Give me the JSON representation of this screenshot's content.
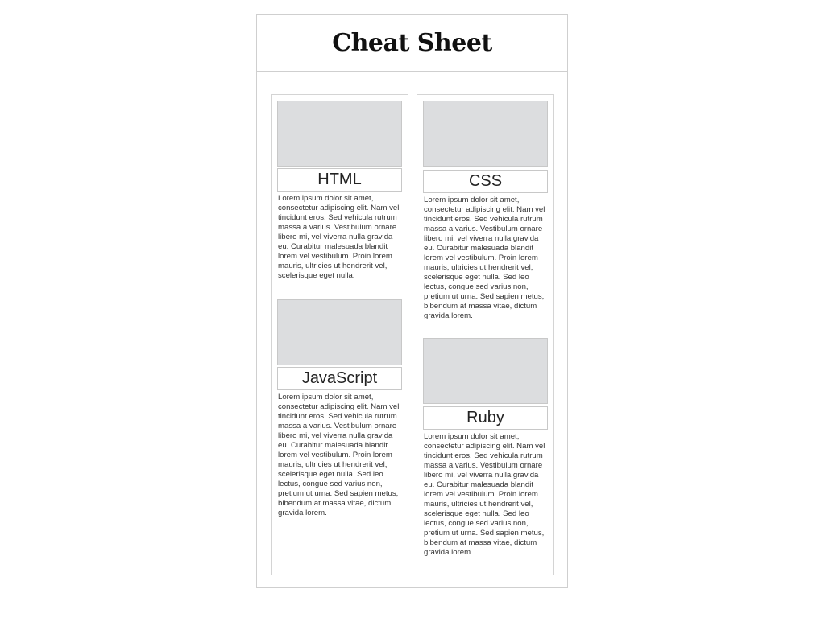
{
  "header": {
    "title": "Cheat Sheet"
  },
  "cards": {
    "html": {
      "title": "HTML",
      "body": "Lorem ipsum dolor sit amet, consectetur adipiscing elit. Nam vel tincidunt eros. Sed vehicula rutrum massa a varius. Vestibulum ornare libero mi, vel viverra nulla gravida eu. Curabitur malesuada blandit lorem vel vestibulum. Proin lorem mauris, ultricies ut hendrerit vel, scelerisque eget nulla."
    },
    "javascript": {
      "title": "JavaScript",
      "body": "Lorem ipsum dolor sit amet, consectetur adipiscing elit. Nam vel tincidunt eros. Sed vehicula rutrum massa a varius. Vestibulum ornare libero mi, vel viverra nulla gravida eu. Curabitur malesuada blandit lorem vel vestibulum. Proin lorem mauris, ultricies ut hendrerit vel, scelerisque eget nulla. Sed leo lectus, congue sed varius non, pretium ut urna. Sed sapien metus, bibendum at massa vitae, dictum gravida lorem."
    },
    "css": {
      "title": "CSS",
      "body": "Lorem ipsum dolor sit amet, consectetur adipiscing elit. Nam vel tincidunt eros. Sed vehicula rutrum massa a varius. Vestibulum ornare libero mi, vel viverra nulla gravida eu. Curabitur malesuada blandit lorem vel vestibulum. Proin lorem mauris, ultricies ut hendrerit vel, scelerisque eget nulla. Sed leo lectus, congue sed varius non, pretium ut urna. Sed sapien metus, bibendum at massa vitae, dictum gravida lorem."
    },
    "ruby": {
      "title": "Ruby",
      "body": "Lorem ipsum dolor sit amet, consectetur adipiscing elit. Nam vel tincidunt eros. Sed vehicula rutrum massa a varius. Vestibulum ornare libero mi, vel viverra nulla gravida eu. Curabitur malesuada blandit lorem vel vestibulum. Proin lorem mauris, ultricies ut hendrerit vel, scelerisque eget nulla. Sed leo lectus, congue sed varius non, pretium ut urna. Sed sapien metus, bibendum at massa vitae, dictum gravida lorem."
    }
  }
}
